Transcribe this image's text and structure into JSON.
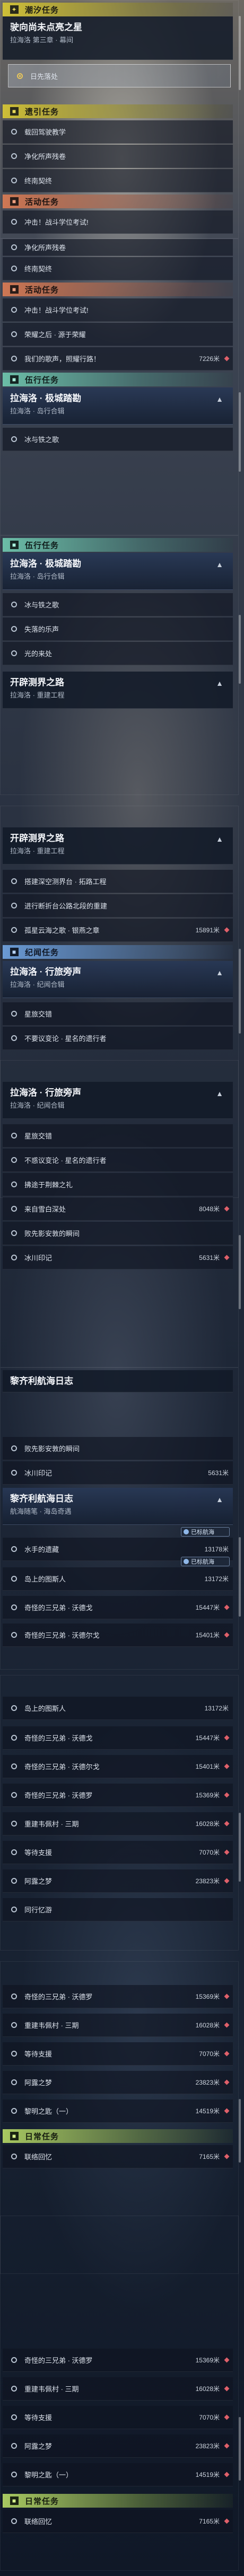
{
  "colors": {
    "daily": "#d4c436",
    "activity": "#d67a54",
    "companion": "#6ec4ac",
    "legend": "#6ea0dc",
    "marker": "#e05a62",
    "selected_ring": "#e8c65a"
  },
  "icons": {
    "section": "square-icon",
    "expand": "chevron-up-icon",
    "quest": "ring-icon",
    "alert": "diamond-icon",
    "tracked": "pin-icon"
  },
  "panel1": {
    "trackbar": "潮汐任务",
    "header": {
      "title": "驶向尚未点亮之星",
      "sub": "拉海洛 第三章 · 幕间"
    },
    "selected": "日先落处",
    "daily_bar": "遗引任务",
    "daily_items": [
      "载回驾驶教学",
      "净化所声残卷",
      "终南契终"
    ],
    "activity_bar": "活动任务",
    "activity_items": [
      "冲击！战斗学位考试!"
    ]
  },
  "panel2": {
    "partial_items": [
      "净化所声残卷",
      "终南契终"
    ],
    "activity_bar": "活动任务",
    "items": [
      {
        "label": "冲击！战斗学位考试!",
        "dist": ""
      },
      {
        "label": "荣耀之后 · 源于荣耀",
        "dist": ""
      },
      {
        "label": "我们的歌声，照耀行路！",
        "dist": "7226米"
      }
    ],
    "companion_bar": "伍行任务",
    "header": {
      "title": "拉海洛 · 极城踏勘",
      "sub": "拉海洛 · 岛行合辑"
    },
    "after": [
      "冰与铁之歌"
    ]
  },
  "panel3": {
    "companion_bar": "伍行任务",
    "header": {
      "title": "拉海洛 · 极城踏勘",
      "sub": "拉海洛 · 岛行合辑"
    },
    "items": [
      "冰与铁之歌",
      "失落的乐声",
      "光的来处"
    ],
    "header2": {
      "title": "开辟测界之路",
      "sub": "拉海洛 · 重建工程"
    }
  },
  "panel4": {
    "header": {
      "title": "开辟测界之路",
      "sub": "拉海洛 · 重建工程"
    },
    "items": [
      {
        "label": "搭建深空测界台 · 拓路工程",
        "dist": ""
      },
      {
        "label": "进行断折台公路北段的重建",
        "dist": ""
      },
      {
        "label": "孤星云海之歌 · 银燕之章",
        "dist": "15891米"
      }
    ],
    "legend_bar": "纪闻任务",
    "header2": {
      "title": "拉海洛 · 行旅旁声",
      "sub": "拉海洛 · 纪闻合辑"
    },
    "after": [
      "星旅交错",
      "不要议变论 · 星名的遗行者"
    ]
  },
  "panel5": {
    "header": {
      "title": "拉海洛 · 行旅旁声",
      "sub": "拉海洛 · 纪闻合辑"
    },
    "items": [
      {
        "label": "星旅交错",
        "dist": ""
      },
      {
        "label": "不惑议变论 · 星名的遗行者",
        "dist": ""
      },
      {
        "label": "拂途于荆棘之礼",
        "dist": ""
      },
      {
        "label": "来自雪白深处",
        "dist": "8048米"
      },
      {
        "label": "败先影安敦的瞬间",
        "dist": ""
      },
      {
        "label": "冰川印记",
        "dist": "5631米"
      }
    ]
  },
  "panel6": {
    "header": {
      "title": "黎齐利航海日志",
      "sub": ""
    },
    "items": [
      {
        "label": "败先影安敦的瞬间",
        "dist": ""
      },
      {
        "label": "冰川印记",
        "dist": "5631米"
      }
    ],
    "header2": {
      "title": "黎齐利航海日志",
      "sub": "航海随笔 · 海岛奇遇"
    },
    "track_tag": "已标航海",
    "items2": [
      {
        "label": "水手的遗藏",
        "dist": "13178米"
      },
      {
        "label": "岛上的图斯人",
        "dist": "13172米"
      },
      {
        "label": "奇怪的三兄弟 · 沃德戈",
        "dist": "15447米"
      },
      {
        "label": "奇怪的三兄弟 · 沃德尔戈",
        "dist": "15401米"
      }
    ]
  },
  "panel7": {
    "items": [
      {
        "label": "岛上的图斯人",
        "dist": "13172米"
      },
      {
        "label": "奇怪的三兄弟 · 沃德戈",
        "dist": "15447米"
      },
      {
        "label": "奇怪的三兄弟 · 沃德尔戈",
        "dist": "15401米"
      },
      {
        "label": "奇怪的三兄弟 · 沃德罗",
        "dist": "15369米"
      },
      {
        "label": "重建韦佩村 · 三期",
        "dist": "16028米"
      },
      {
        "label": "等待支援",
        "dist": "7070米"
      },
      {
        "label": "阿露之梦",
        "dist": "23823米"
      },
      {
        "label": "同行忆游",
        "dist": ""
      }
    ]
  },
  "panel8": {
    "items": [
      {
        "label": "奇怪的三兄弟 · 沃德罗",
        "dist": "15369米"
      },
      {
        "label": "重建韦佩村 · 三期",
        "dist": "16028米"
      },
      {
        "label": "等待支援",
        "dist": "7070米"
      },
      {
        "label": "阿露之梦",
        "dist": "23823米"
      },
      {
        "label": "黎明之匙（一）",
        "dist": "14519米"
      }
    ],
    "daily_bar": "日常任务",
    "daily_items": [
      {
        "label": "联络回忆",
        "dist": "7165米"
      }
    ]
  },
  "panel9": {
    "items": [
      {
        "label": "奇怪的三兄弟 · 沃德罗",
        "dist": "15369米"
      },
      {
        "label": "重建韦佩村 · 三期",
        "dist": "16028米"
      },
      {
        "label": "等待支援",
        "dist": "7070米"
      },
      {
        "label": "阿露之梦",
        "dist": "23823米"
      },
      {
        "label": "黎明之匙（一）",
        "dist": "14519米"
      }
    ],
    "daily_bar": "日常任务",
    "daily_items": [
      {
        "label": "联络回忆",
        "dist": "7165米"
      }
    ]
  }
}
